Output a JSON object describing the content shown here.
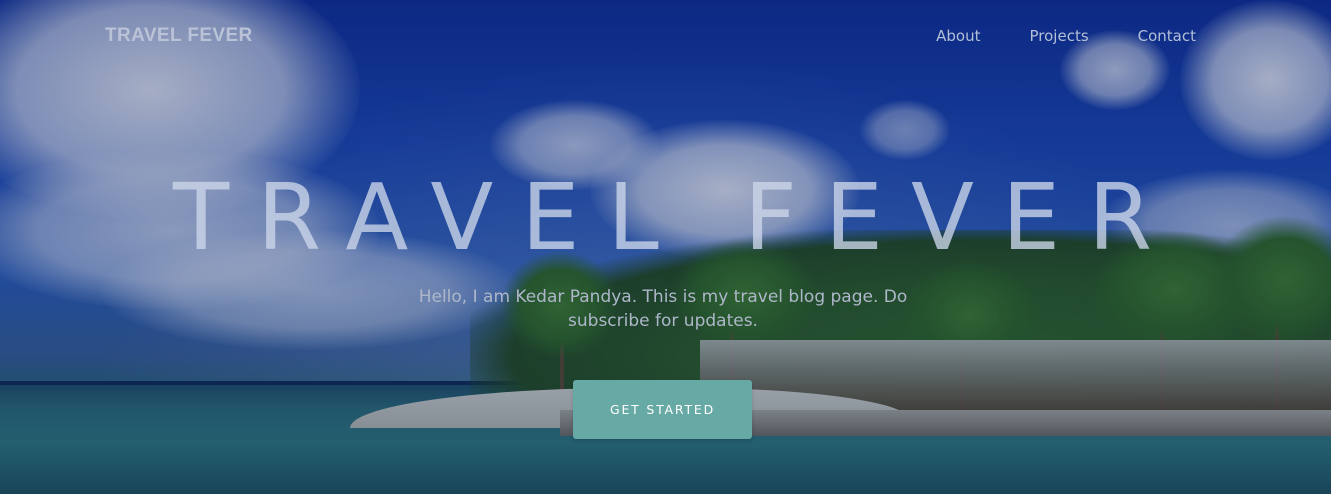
{
  "nav": {
    "brand": "TRAVEL FEVER",
    "links": [
      {
        "label": "About"
      },
      {
        "label": "Projects"
      },
      {
        "label": "Contact"
      }
    ]
  },
  "hero": {
    "headline": "TRAVEL FEVER",
    "tagline": "Hello, I am Kedar Pandya. This is my travel blog page. Do subscribe for updates.",
    "cta_label": "GET STARTED",
    "background_description_icon": "tropical-island-photo"
  },
  "colors": {
    "cta_background": "#67a9a4",
    "sky": "#1a48b8",
    "sea": "#2e7b80"
  }
}
